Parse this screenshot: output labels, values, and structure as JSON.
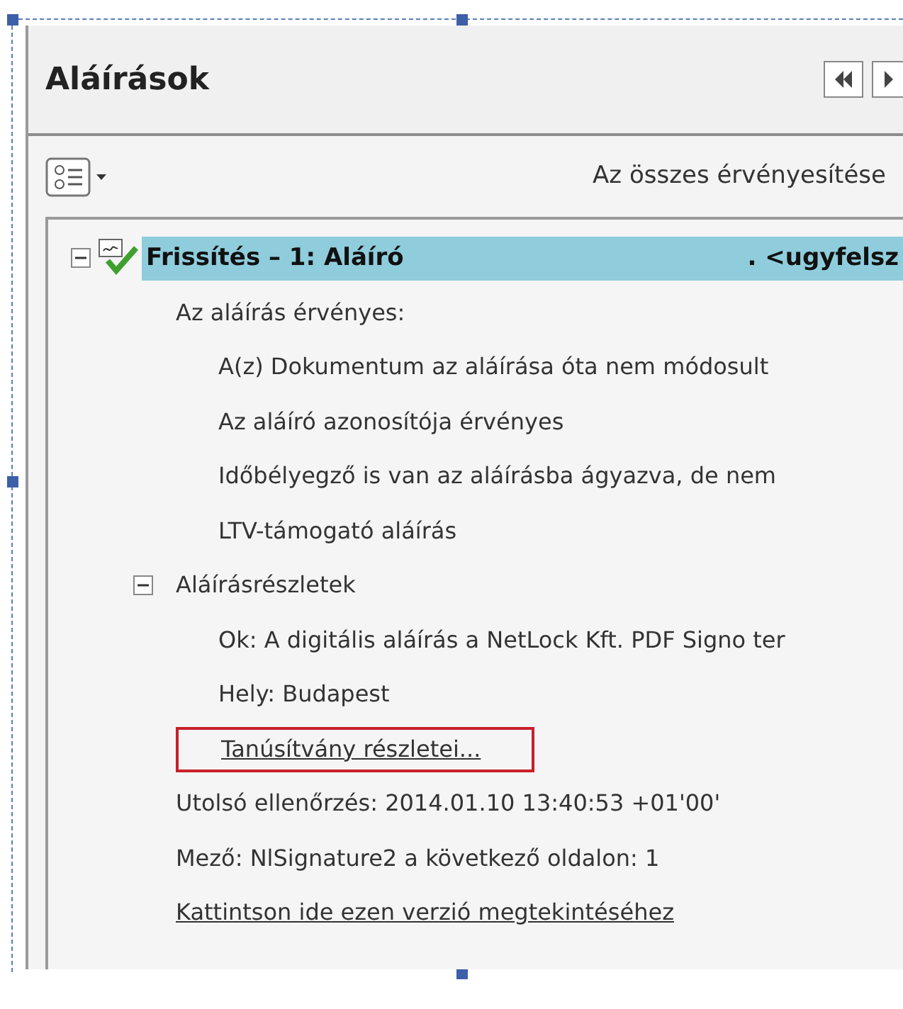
{
  "panel": {
    "title": "Aláírások"
  },
  "toolbar": {
    "validate_all": "Az összes érvényesítése"
  },
  "tree": [
    {
      "label": "Frissítés – 1: Aláíró",
      "label_end": ". <ugyfelsz",
      "selected": true,
      "expanded": true,
      "children": [
        {
          "label": "Az aláírás érvényes:",
          "children": [
            {
              "label": "A(z) Dokumentum az aláírása óta nem módosult"
            },
            {
              "label": "Az aláíró azonosítója érvényes"
            },
            {
              "label": "Időbélyegző is van az aláírásba ágyazva, de nem"
            },
            {
              "label": "LTV-támogató aláírás"
            }
          ]
        },
        {
          "label": "Aláírásrészletek",
          "expanded": true,
          "children": [
            {
              "label": "Ok: A digitális aláírás a NetLock Kft. PDF Signo ter"
            },
            {
              "label": "Hely: Budapest"
            },
            {
              "label": "Tanúsítvány részletei...",
              "kind": "link",
              "outlined": true
            }
          ]
        },
        {
          "label": "Utolsó ellenőrzés: 2014.01.10 13:40:53 +01'00'"
        },
        {
          "label": "Mező: NlSignature2 a következő oldalon: 1"
        },
        {
          "label": "Kattintson ide ezen verzió megtekintéséhez",
          "kind": "link",
          "outlined": false
        }
      ]
    }
  ]
}
